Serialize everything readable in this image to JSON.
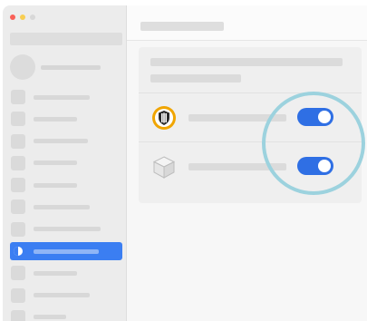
{
  "window": {
    "traffic_lights": [
      {
        "name": "close",
        "color": "#f96057"
      },
      {
        "name": "minimize",
        "color": "#f8ce52"
      },
      {
        "name": "zoom",
        "color": "#d8d8d8"
      }
    ]
  },
  "sidebar": {
    "active_index": 7,
    "item_count": 11,
    "active_color": "#3b7ef2"
  },
  "main": {
    "card": {
      "rows": [
        {
          "icon": "shield-icon",
          "toggle_on": true
        },
        {
          "icon": "cube-icon",
          "toggle_on": true
        }
      ]
    }
  },
  "colors": {
    "toggle_on": "#2f6fe4",
    "highlight_ring": "#9cd2de",
    "shield_badge": "#f0a500"
  }
}
